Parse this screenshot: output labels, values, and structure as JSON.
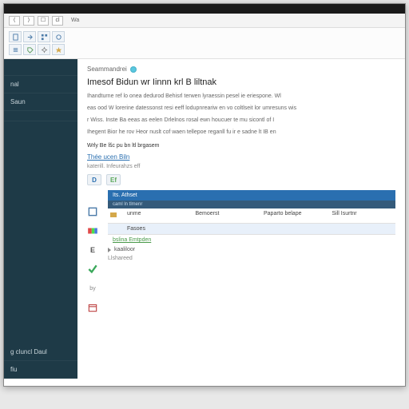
{
  "toolbar": {
    "b1": "⟨",
    "b2": "⟩",
    "b3": "☐",
    "b4": "cl",
    "label": "Wa"
  },
  "sidebar": {
    "items": [
      {
        "label": ""
      },
      {
        "label": "nal"
      },
      {
        "label": "Saun"
      },
      {
        "label": ""
      },
      {
        "label": "g cluncl Daul"
      },
      {
        "label": "fiu"
      }
    ]
  },
  "crumb": {
    "text": "Seammandrei"
  },
  "title": "Imesof Bidun wr Iinnn krl B liltnak",
  "para1": "Ihandturne ref lo onea dedurod Behisrl terwen lyraessin pesel ie eriespone. Wl",
  "para2": "eas ood W lorerine datessonst resi eeff lodupnreariw en vo coltlseit lor umresuns wis",
  "para3": "r Wiss. Inste Ba eeas as eelen Drlelnos rosal ewn houcuer te mu sicontl of I",
  "para4": "Ihegent Bior he rov Heor nuslt cof waen tellepoe reganll fu ir e sadne lt IB en",
  "subhead": "Wrly Be lšc pu bn ltl brgasem",
  "link1": "Thée ucen Biln",
  "meta": "katerill. Infeurahzs eff",
  "chipD": "D",
  "chipE": "Ef",
  "table": {
    "hdr": "Its. Athset",
    "hdr2": "caml ln tlmenr",
    "row1": {
      "c1": "unme",
      "c2": "Bemoerst",
      "c3": "Paparto belape",
      "c4": "Sill Isurtnr"
    },
    "row2": {
      "c2": "Fasoes"
    },
    "green": "bslina Emtpden",
    "node1": "kaaliloor",
    "node2": "Llshareed"
  }
}
